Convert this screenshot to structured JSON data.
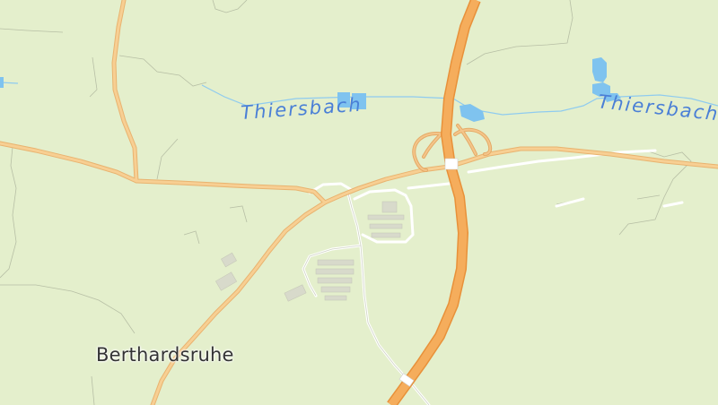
{
  "map": {
    "labels": {
      "town": "Berthardsruhe",
      "stream_west": "Thiersbach",
      "stream_east": "Thiersbach"
    },
    "colors": {
      "land": "#e4efcc",
      "water": "#7fc3ef",
      "water_label": "#4a7fd6",
      "motorway": "#f3a64a",
      "main_road": "#f7c98a",
      "minor_road": "#ffffff",
      "boundary": "#b9c2a8",
      "building": "#d6d8c8"
    }
  }
}
